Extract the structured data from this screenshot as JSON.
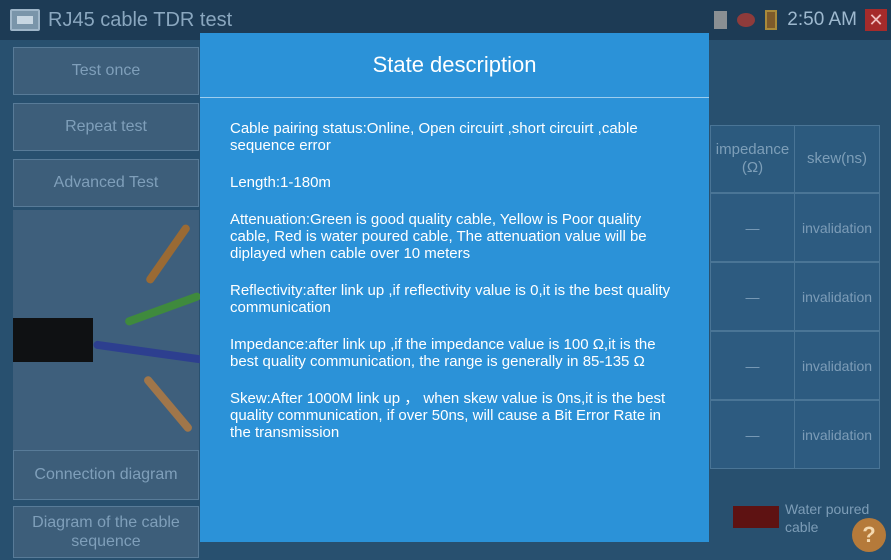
{
  "window": {
    "title": "RJ45 cable TDR test",
    "clock": "2:50 AM"
  },
  "sidebar": {
    "buttons": [
      {
        "label": "Test once"
      },
      {
        "label": "Repeat test"
      },
      {
        "label": "Advanced Test"
      },
      {
        "label": "Connection diagram"
      },
      {
        "label": "Diagram of the cable sequence"
      }
    ]
  },
  "table": {
    "headers": {
      "impedance": "impedance (Ω)",
      "skew": "skew(ns)"
    },
    "rows": [
      {
        "impedance": "—",
        "skew": "invalidation"
      },
      {
        "impedance": "—",
        "skew": "invalidation"
      },
      {
        "impedance": "—",
        "skew": "invalidation"
      },
      {
        "impedance": "—",
        "skew": "invalidation"
      }
    ]
  },
  "legend": {
    "label": "Water poured cable",
    "color": "#5e1212"
  },
  "modal": {
    "title": "State description",
    "items": [
      "Cable pairing status:Online, Open circuirt ,short circuirt ,cable sequence error",
      "Length:1-180m",
      "Attenuation:Green is good quality cable, Yellow is Poor quality cable, Red is water poured cable, The attenuation value will be diplayed when cable over 10 meters",
      "Reflectivity:after link up ,if reflectivity value is 0,it is the best quality communication",
      "Impedance:after link up ,if the impedance value is 100 Ω,it is the best quality communication, the range is generally in 85-135 Ω",
      "Skew:After 1000M link up ， when skew value is 0ns,it is the best quality communication, if over 50ns, will cause a Bit Error Rate in the transmission"
    ]
  }
}
